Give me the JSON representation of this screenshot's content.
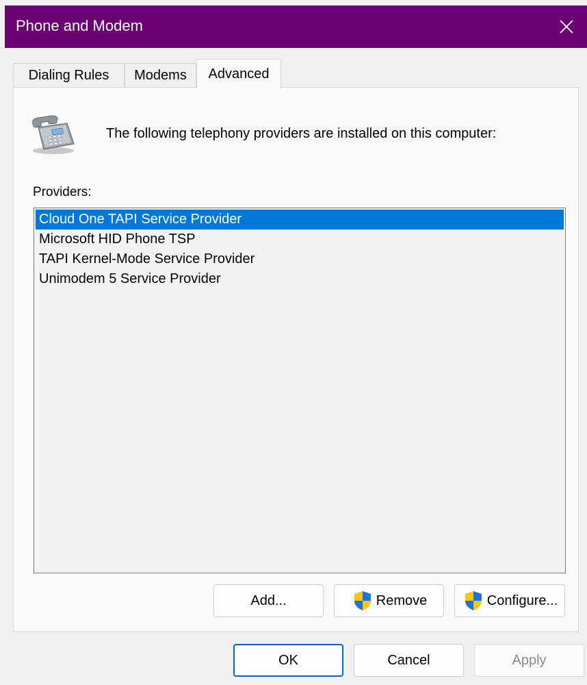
{
  "window": {
    "title": "Phone and Modem",
    "close_icon": "close-icon",
    "title_bar_color": "#6b0072"
  },
  "tabs": [
    {
      "label": "Dialing Rules",
      "active": false
    },
    {
      "label": "Modems",
      "active": false
    },
    {
      "label": "Advanced",
      "active": true
    }
  ],
  "advanced": {
    "icon": "telephone-icon",
    "intro": "The following telephony providers are installed on this computer:",
    "providers_label": "Providers:",
    "providers": [
      {
        "name": "Cloud One TAPI Service Provider",
        "selected": true
      },
      {
        "name": "Microsoft HID Phone TSP",
        "selected": false
      },
      {
        "name": "TAPI Kernel-Mode Service Provider",
        "selected": false
      },
      {
        "name": "Unimodem 5 Service Provider",
        "selected": false
      }
    ],
    "buttons": {
      "add": "Add...",
      "remove": "Remove",
      "configure": "Configure...",
      "shield_icon": "uac-shield-icon"
    },
    "selection_color": "#0078d7"
  },
  "footer": {
    "ok": "OK",
    "cancel": "Cancel",
    "apply": "Apply",
    "apply_enabled": false
  }
}
